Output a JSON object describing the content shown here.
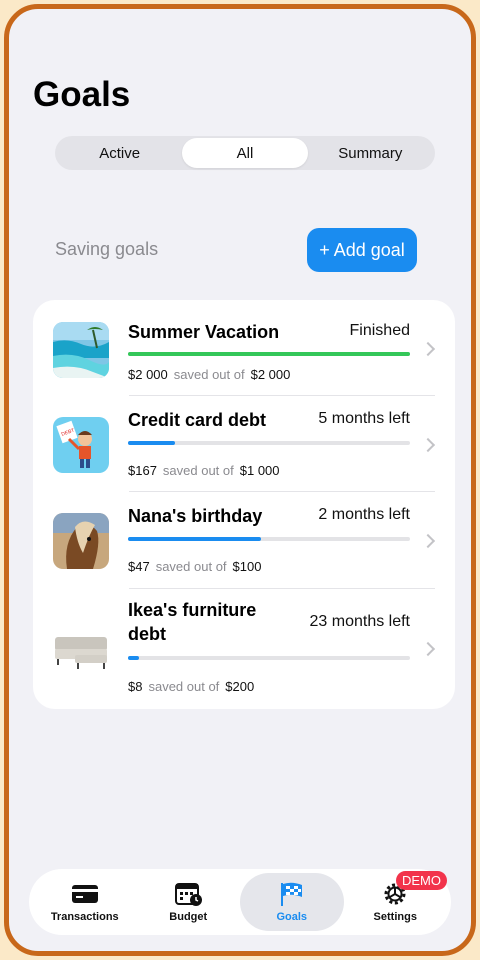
{
  "header": {
    "title": "Goals"
  },
  "segments": [
    {
      "label": "Active",
      "selected": false
    },
    {
      "label": "All",
      "selected": true
    },
    {
      "label": "Summary",
      "selected": false
    }
  ],
  "section": {
    "label": "Saving goals",
    "add_button": "+ Add goal"
  },
  "goals": [
    {
      "name": "Summer Vacation",
      "status": "Finished",
      "saved": "$2 000",
      "saved_label": "saved out of",
      "target": "$2 000",
      "progress": 1.0,
      "color": "#34c759",
      "thumb": "beach-photo"
    },
    {
      "name": "Credit card debt",
      "status": "5 months left",
      "saved": "$167",
      "saved_label": "saved out of",
      "target": "$1 000",
      "progress": 0.167,
      "color": "#1a8cf0",
      "thumb": "debt-free-illustration"
    },
    {
      "name": "Nana's birthday",
      "status": "2 months left",
      "saved": "$47",
      "saved_label": "saved out of",
      "target": "$100",
      "progress": 0.47,
      "color": "#1a8cf0",
      "thumb": "horse-photo"
    },
    {
      "name": "Ikea's furniture debt",
      "status": "23 months left",
      "saved": "$8",
      "saved_label": "saved out of",
      "target": "$200",
      "progress": 0.04,
      "color": "#1a8cf0",
      "thumb": "sofa-photo"
    }
  ],
  "tabbar": {
    "items": [
      {
        "label": "Transactions",
        "icon": "credit-card-icon",
        "active": false
      },
      {
        "label": "Budget",
        "icon": "calendar-clock-icon",
        "active": false
      },
      {
        "label": "Goals",
        "icon": "checkered-flag-icon",
        "active": true
      },
      {
        "label": "Settings",
        "icon": "gear-icon",
        "active": false
      }
    ],
    "badge": "DEMO"
  },
  "colors": {
    "accent": "#1a8cf0",
    "success": "#34c759",
    "badge": "#f2334b",
    "frame": "#c8681a"
  }
}
